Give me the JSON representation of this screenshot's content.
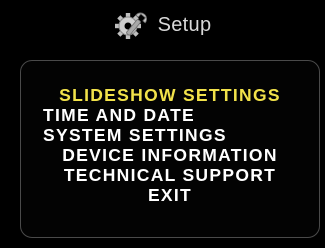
{
  "header": {
    "title": "Setup",
    "icon": "gear-wrench-icon"
  },
  "menu": {
    "selected_index": 0,
    "selected_color": "#f2e24a",
    "items": [
      {
        "label": "SLIDESHOW SETTINGS"
      },
      {
        "label": "TIME AND DATE"
      },
      {
        "label": "SYSTEM SETTINGS"
      },
      {
        "label": "DEVICE INFORMATION"
      },
      {
        "label": "TECHNICAL SUPPORT"
      },
      {
        "label": "EXIT"
      }
    ]
  }
}
